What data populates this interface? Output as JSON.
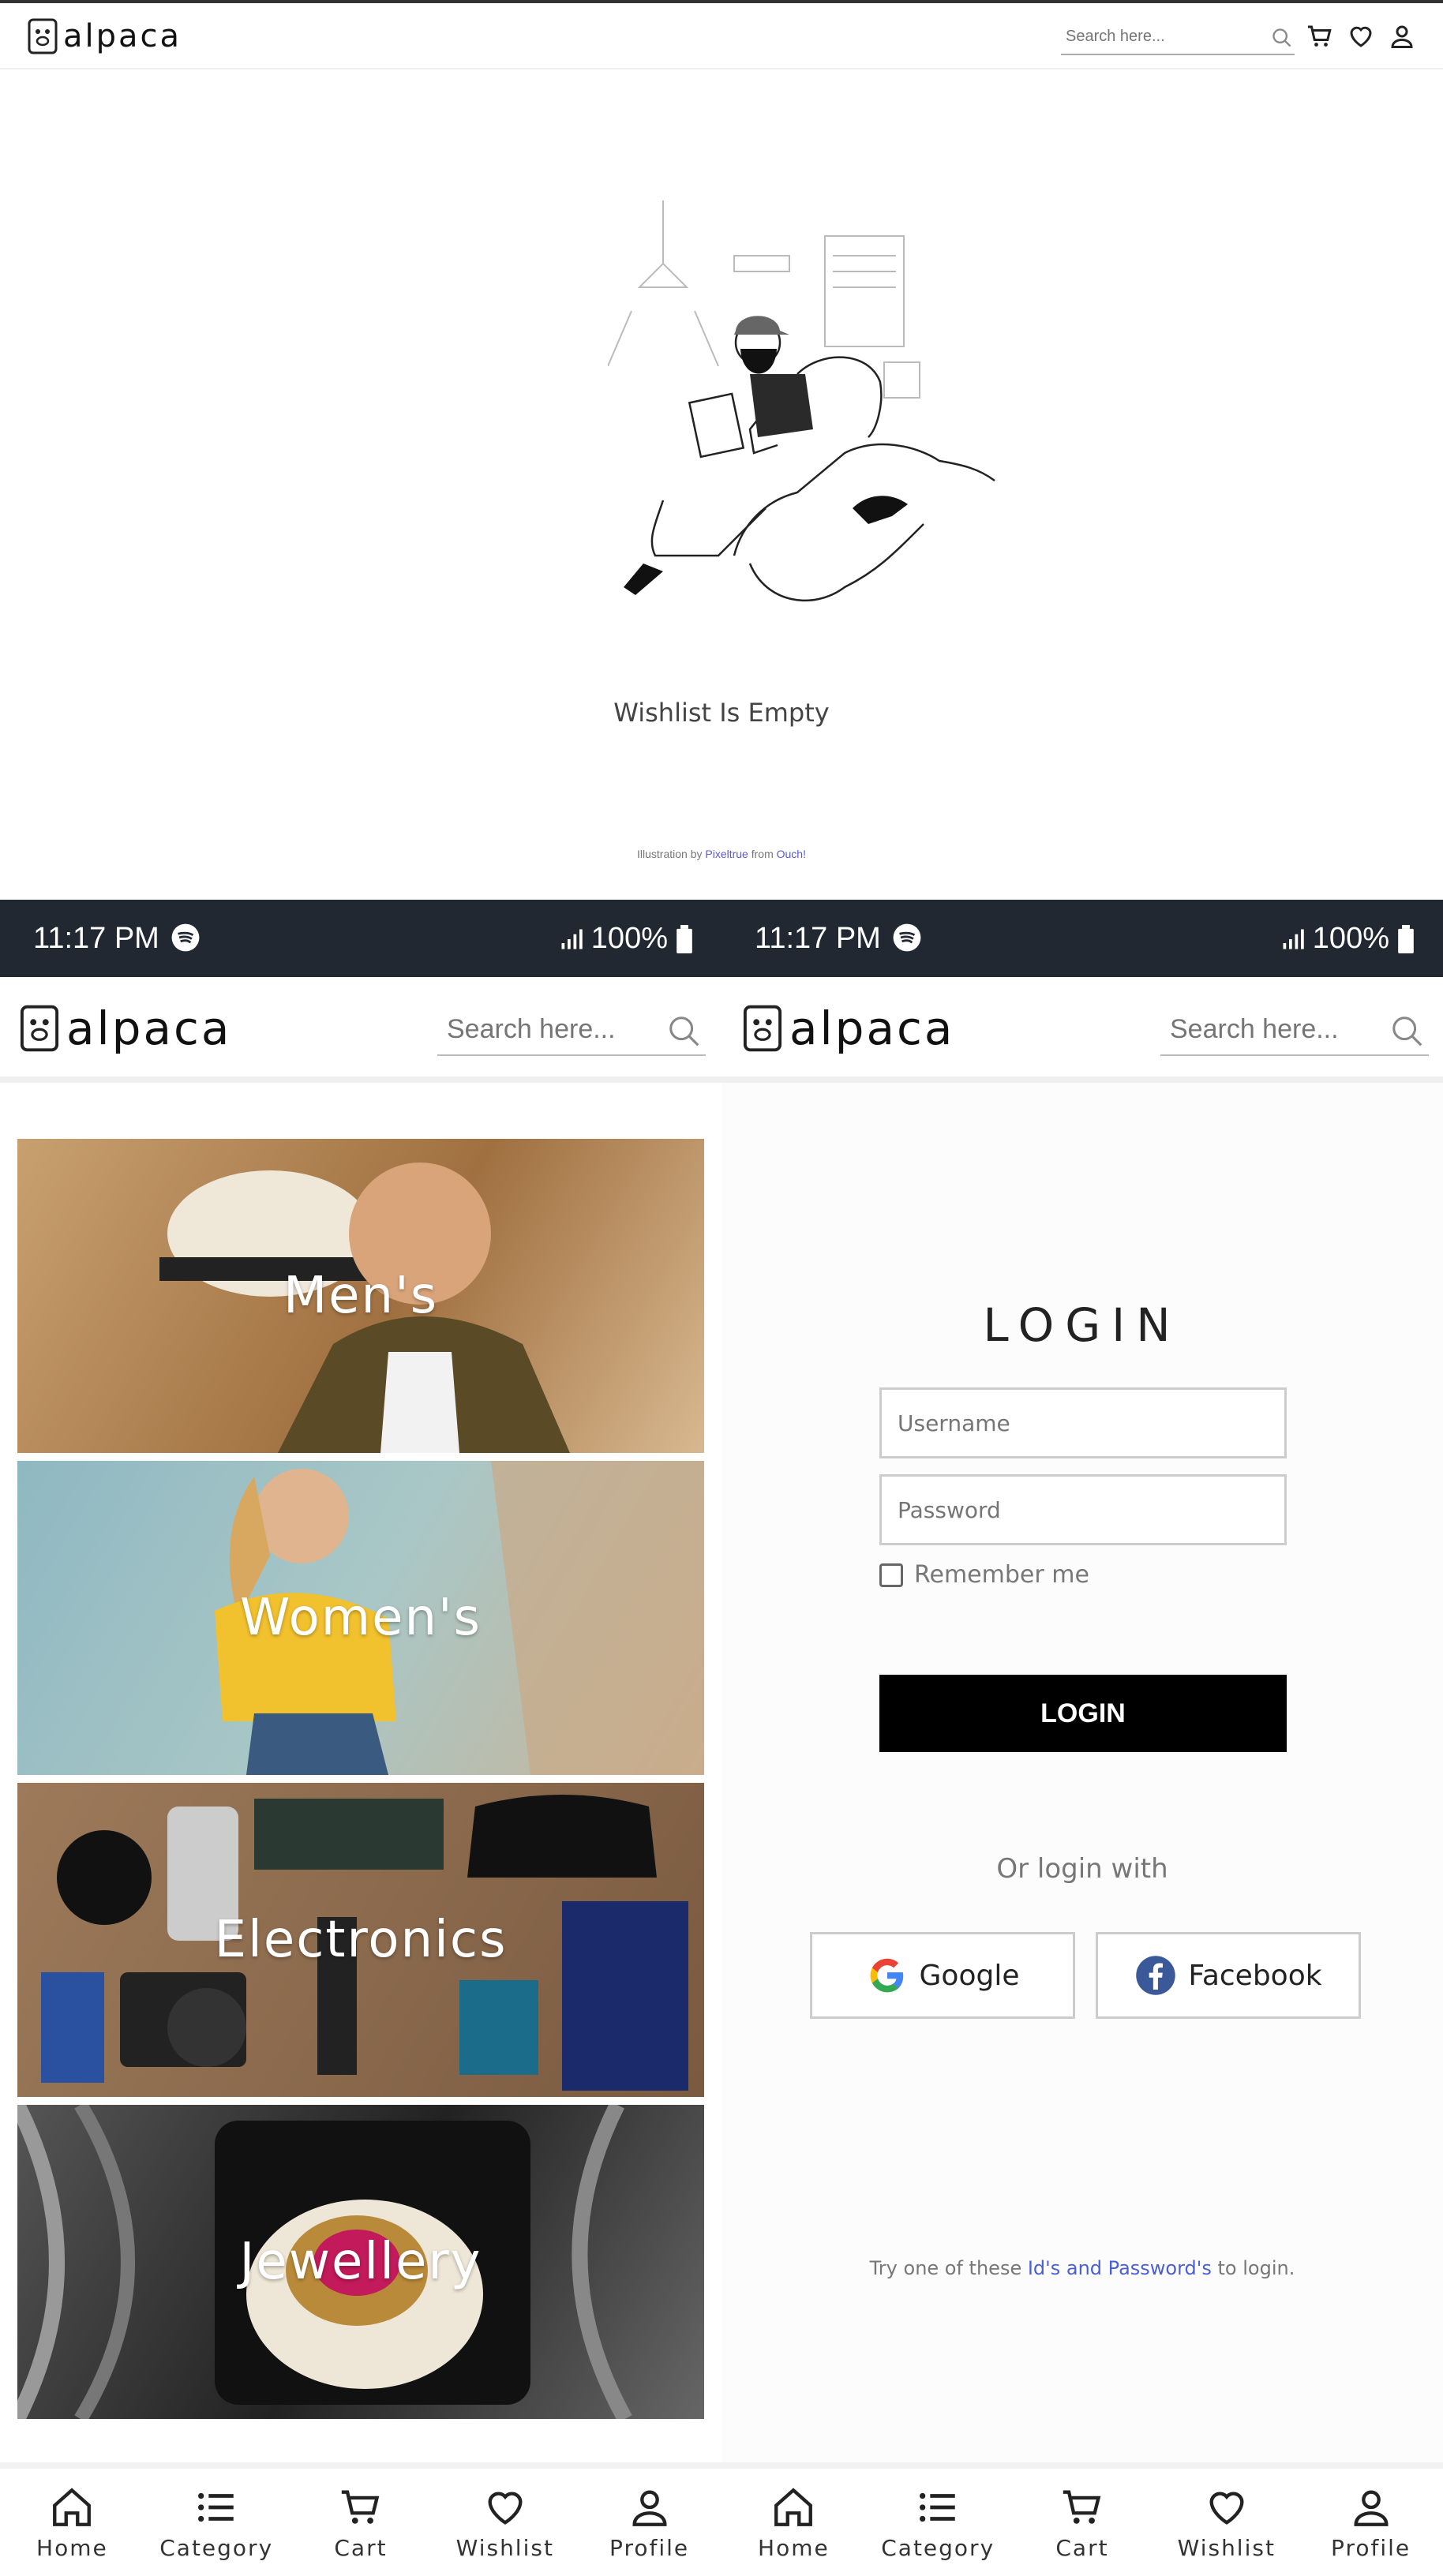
{
  "desktop": {
    "logo": "alpaca",
    "search_placeholder": "Search here...",
    "empty_message": "Wishlist Is Empty",
    "credit": {
      "prefix": "Illustration by ",
      "author": "Pixeltrue",
      "middle": " from ",
      "source": "Ouch!"
    }
  },
  "status_bar": {
    "time": "11:17 PM",
    "battery": "100%"
  },
  "mobile_header": {
    "logo": "alpaca",
    "search_placeholder": "Search here..."
  },
  "categories": [
    {
      "label": "Men's",
      "color1": "#b88f62",
      "color2": "#6b4a2a"
    },
    {
      "label": "Women's",
      "color1": "#8ab2b8",
      "color2": "#c79b52"
    },
    {
      "label": "Electronics",
      "color1": "#8a6a4e",
      "color2": "#2c2c30"
    },
    {
      "label": "Jewellery",
      "color1": "#3a3a3a",
      "color2": "#111111"
    }
  ],
  "login": {
    "title": "LOGIN",
    "username_placeholder": "Username",
    "password_placeholder": "Password",
    "remember_label": "Remember me",
    "button_label": "LOGIN",
    "or_login_with": "Or login with",
    "google_label": "Google",
    "facebook_label": "Facebook",
    "hint": {
      "prefix": "Try one of these ",
      "link": "Id's and Password's",
      "suffix": " to login."
    }
  },
  "bottom_nav": [
    {
      "label": "Home",
      "icon": "home-icon"
    },
    {
      "label": "Category",
      "icon": "list-icon"
    },
    {
      "label": "Cart",
      "icon": "cart-icon"
    },
    {
      "label": "Wishlist",
      "icon": "heart-icon"
    },
    {
      "label": "Profile",
      "icon": "user-icon"
    }
  ],
  "colors": {
    "status_bar": "#222831",
    "accent_link": "#4a5fd6",
    "button": "#000000",
    "facebook": "#3b5998"
  }
}
